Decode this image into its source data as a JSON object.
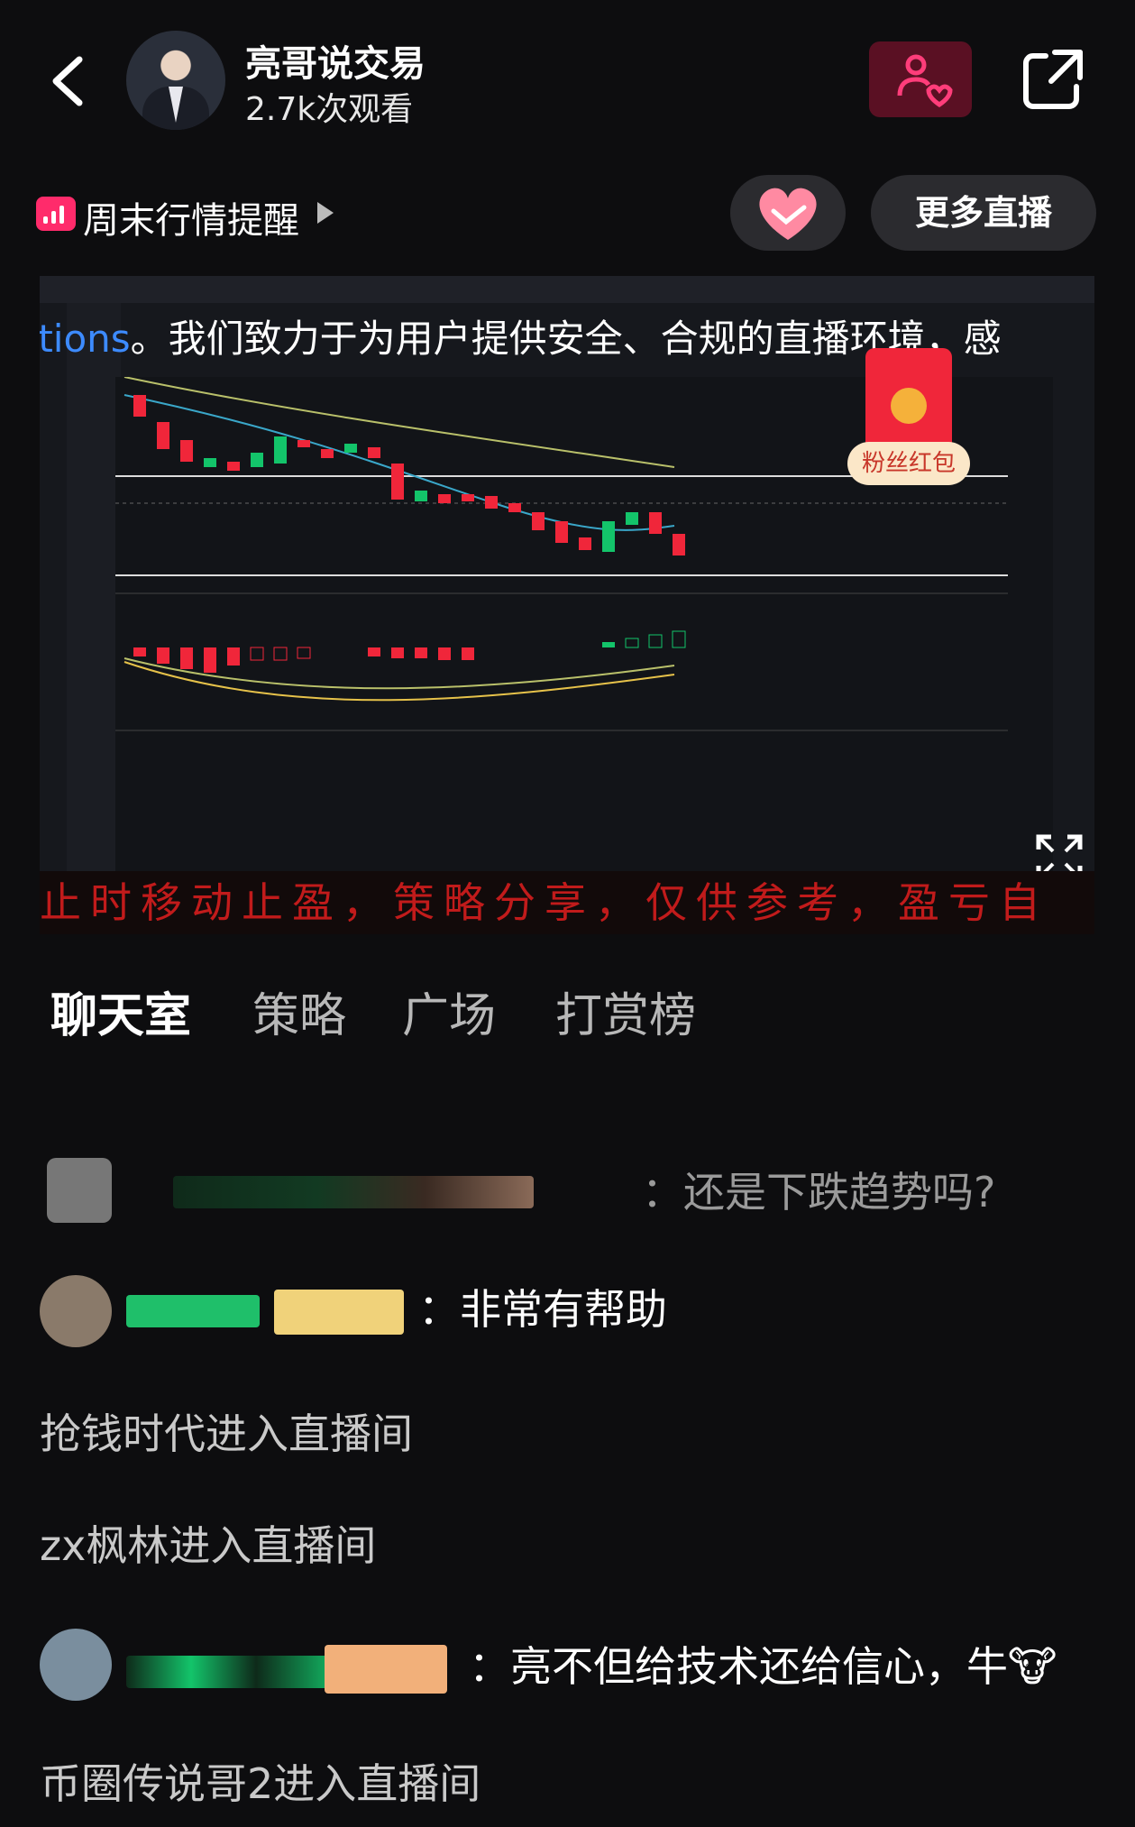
{
  "header": {
    "host_name": "亮哥说交易",
    "views": "2.7k次观看"
  },
  "subline": {
    "topic": "周末行情提醒",
    "more_live": "更多直播"
  },
  "video": {
    "ticker_blue": "ditions",
    "ticker_text": "。我们致力于为用户提供安全、合规的直播环境，感",
    "red_packet_label": "粉丝红包",
    "banner_text": "止时移动止盈，策略分享，仅供参考，盈亏自"
  },
  "tabs": [
    "聊天室",
    "策略",
    "广场",
    "打赏榜"
  ],
  "chat": [
    {
      "type": "msg",
      "text": "：还是下跌趋势吗?"
    },
    {
      "type": "msg",
      "text": "：非常有帮助"
    },
    {
      "type": "system",
      "text": "抢钱时代进入直播间"
    },
    {
      "type": "system",
      "text": "zx枫林进入直播间"
    },
    {
      "type": "msg",
      "text": "：亮不但给技术还给信心，牛🐮"
    },
    {
      "type": "system",
      "text": "币圈传说哥2进入直播间"
    }
  ],
  "colors": {
    "accent": "#ff2b6b",
    "background": "#0d0d0f",
    "up": "#13c46a",
    "down": "#f0263a"
  },
  "icons": [
    "back-icon",
    "follow-heart-icon",
    "share-icon",
    "live-bars-icon",
    "handshake-heart-icon",
    "fullscreen-icon"
  ]
}
